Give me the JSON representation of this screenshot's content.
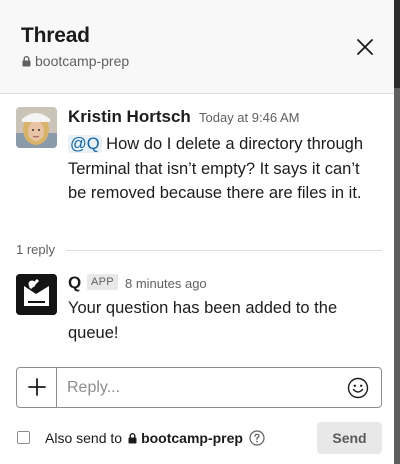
{
  "header": {
    "title": "Thread",
    "channel": "bootcamp-prep",
    "close_icon": "close-icon"
  },
  "thread": {
    "parent": {
      "author": "Kristin Hortsch",
      "timestamp": "Today at 9:46 AM",
      "mention": "@Q",
      "text": " How do I delete a directory through Terminal that isn’t empty? It says it can’t be removed because there are files in it."
    },
    "replies_count": "1 reply",
    "replies": [
      {
        "author": "Q",
        "badge": "APP",
        "timestamp": "8 minutes ago",
        "text": "Your question has been added to the queue!"
      }
    ]
  },
  "composer": {
    "placeholder": "Reply...",
    "value": ""
  },
  "footer": {
    "also_send_label": "Also send to",
    "channel": "bootcamp-prep",
    "send_label": "Send",
    "also_send_checked": false
  },
  "colors": {
    "header_bg": "#f8f8f8",
    "mention": "#1264a3",
    "send_bg": "#e8e8e8"
  }
}
